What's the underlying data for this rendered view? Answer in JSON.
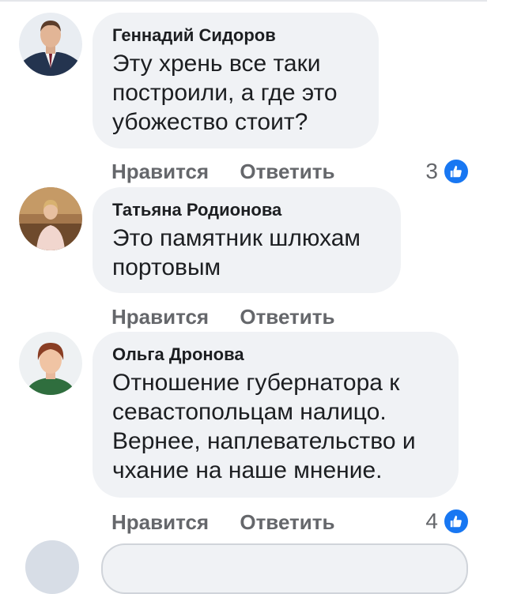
{
  "comments": [
    {
      "author": "Геннадий Сидоров",
      "text": "Эту хрень все таки построили, а где это убожество стоит?",
      "like_label": "Нравится",
      "reply_label": "Ответить",
      "reaction_count": "3",
      "reaction_icon": "thumbs-up-icon"
    },
    {
      "author": "Татьяна Родионова",
      "text": "Это памятник шлюхам портовым",
      "like_label": "Нравится",
      "reply_label": "Ответить"
    },
    {
      "author": "Ольга Дронова",
      "text": "Отношение губернатора к севастопольцам налицо. Вернее, наплевательство и чхание на наше мнение.",
      "like_label": "Нравится",
      "reply_label": "Ответить",
      "reaction_count": "4",
      "reaction_icon": "thumbs-up-icon"
    }
  ],
  "colors": {
    "bubble": "#f0f2f5",
    "text": "#1c1e21",
    "meta": "#65676b",
    "like": "#1877f2"
  }
}
